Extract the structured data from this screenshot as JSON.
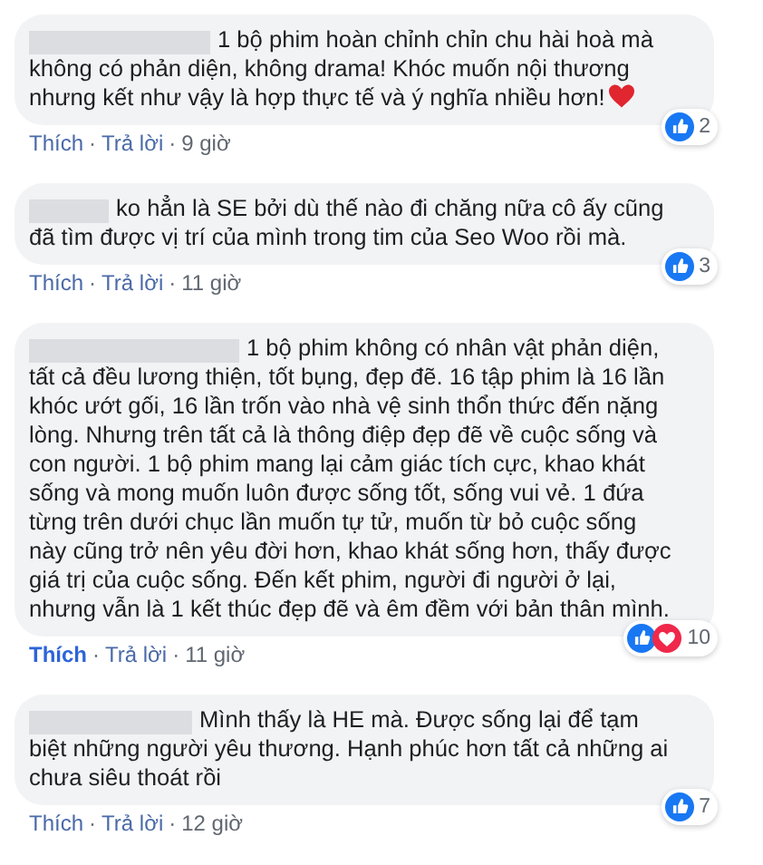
{
  "comments": [
    {
      "text": "1 bộ phim hoàn chỉnh chỉn chu hài hoà mà không có phản diện, không drama! Khóc muốn nội thương nhưng kết như vậy là hợp thực tế và ý nghĩa nhiều hơn!",
      "trailing_heart": true,
      "reactions": [
        {
          "kind": "like"
        }
      ],
      "reaction_count": "2",
      "like_label": "Thích",
      "liked": false,
      "separator_1": "·",
      "reply_label": "Trả lời",
      "separator_2": "·",
      "time": "9 giờ"
    },
    {
      "text": "ko hẳn là SE bởi dù thế nào đi chăng nữa cô ấy cũng đã tìm được vị trí của mình trong tim của Seo Woo rồi mà.",
      "trailing_heart": false,
      "reactions": [
        {
          "kind": "like"
        }
      ],
      "reaction_count": "3",
      "like_label": "Thích",
      "liked": false,
      "separator_1": "·",
      "reply_label": "Trả lời",
      "separator_2": "·",
      "time": "11 giờ"
    },
    {
      "text": "1 bộ phim không có nhân vật phản diện, tất cả đều lương thiện, tốt bụng, đẹp đẽ. 16 tập phim là 16 lần khóc ướt gối, 16 lần trốn vào nhà vệ sinh thổn thức đến nặng lòng. Nhưng trên tất cả là thông điệp đẹp đẽ về cuộc sống và con người. 1 bộ phim mang lại cảm giác tích cực, khao khát sống và mong muốn luôn được sống tốt, sống vui vẻ. 1 đứa từng trên dưới chục lần muốn tự tử, muốn từ bỏ cuộc sống này cũng trở nên yêu đời hơn, khao khát sống hơn, thấy được giá trị của cuộc sống. Đến kết phim, người đi người ở lại, nhưng vẫn là 1 kết thúc đẹp đẽ và êm đềm với bản thân mình.",
      "trailing_heart": false,
      "reactions": [
        {
          "kind": "like"
        },
        {
          "kind": "love"
        }
      ],
      "reaction_count": "10",
      "like_label": "Thích",
      "liked": true,
      "separator_1": "·",
      "reply_label": "Trả lời",
      "separator_2": "·",
      "time": "11 giờ"
    },
    {
      "text": "Mình thấy là HE mà. Được sống lại để tạm biệt những người yêu thương. Hạnh phúc hơn tất cả những ai chưa siêu thoát rồi",
      "trailing_heart": false,
      "reactions": [
        {
          "kind": "like"
        }
      ],
      "reaction_count": "7",
      "like_label": "Thích",
      "liked": false,
      "separator_1": "·",
      "reply_label": "Trả lời",
      "separator_2": "·",
      "time": "12 giờ"
    }
  ]
}
